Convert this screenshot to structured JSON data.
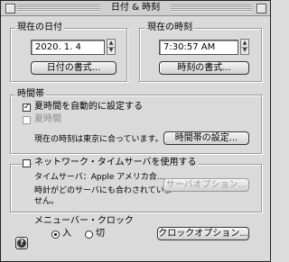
{
  "window": {
    "title": "日付 & 時刻"
  },
  "date_section": {
    "label": "現在の日付",
    "value": "2020. 1. 4",
    "format_button": "日付の書式..."
  },
  "time_section": {
    "label": "現在の時刻",
    "value": "7:30:57 AM",
    "format_button": "時刻の書式..."
  },
  "timezone_section": {
    "label": "時間帯",
    "dst_auto_label": "夏時間を自動的に設定する",
    "dst_auto_checked": true,
    "dst_label": "夏時間",
    "dst_checked": false,
    "status_text": "現在の時刻は東京に合っています。",
    "settings_button": "時間帯の設定..."
  },
  "network_section": {
    "checkbox_label": "ネットワーク・タイムサーバを使用する",
    "checked": false,
    "server_text": "タイムサーバ：Apple アメリカ合...",
    "note_line1": "時計がどのサーバにも合わされていま",
    "note_line2": "せん。",
    "options_button": "サーバオプション..."
  },
  "menubar_clock": {
    "label": "メニューバー・クロック",
    "on_label": "入",
    "off_label": "切",
    "selected": "on",
    "options_button": "クロックオプション..."
  },
  "help_button": {
    "glyph": "?"
  }
}
